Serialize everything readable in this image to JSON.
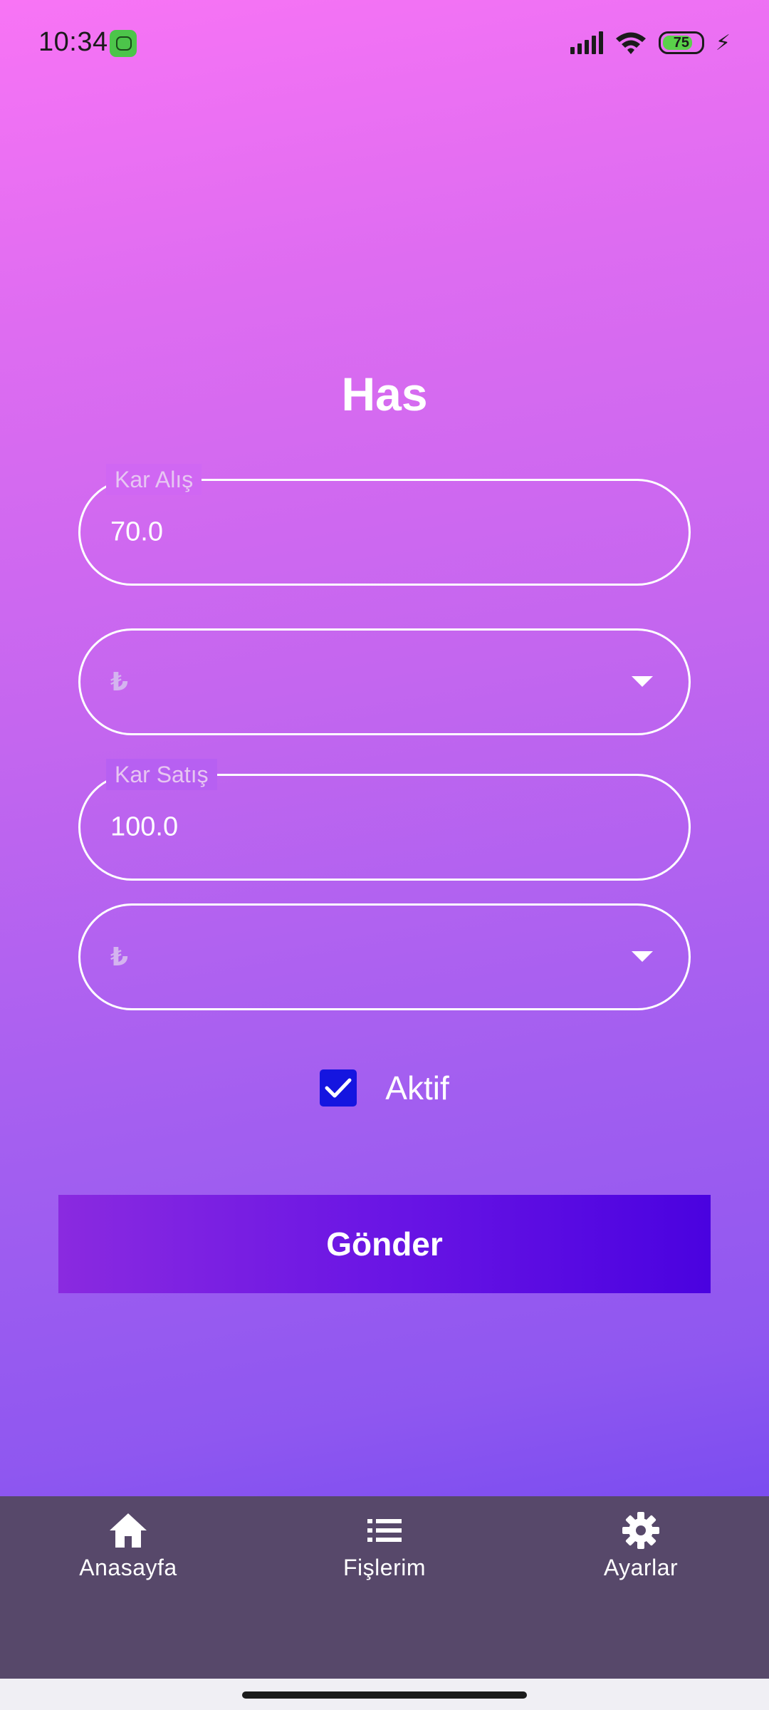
{
  "status_bar": {
    "time": "10:34",
    "battery_level": "75",
    "icons": [
      "app-badge-icon",
      "signal-icon",
      "wifi-icon",
      "battery-icon",
      "charging-bolt-icon"
    ]
  },
  "page": {
    "title": "Has"
  },
  "form": {
    "buy_profit": {
      "label": "Kar Alış",
      "value": "70.0"
    },
    "buy_currency": {
      "value": "₺"
    },
    "sell_profit": {
      "label": "Kar Satış",
      "value": "100.0"
    },
    "sell_currency": {
      "value": "₺"
    },
    "active": {
      "label": "Aktif",
      "checked": true
    },
    "submit_label": "Gönder"
  },
  "bottom_nav": {
    "items": [
      {
        "label": "Anasayfa",
        "icon": "home-icon"
      },
      {
        "label": "Fişlerim",
        "icon": "list-icon"
      },
      {
        "label": "Ayarlar",
        "icon": "gear-icon"
      }
    ]
  },
  "colors": {
    "gradient_top": "#f874f5",
    "gradient_bottom": "#7c4df0",
    "checkbox": "#1515e0",
    "submit_left": "#8a2ae0",
    "submit_right": "#4a02e0",
    "nav_background": "#57486a"
  }
}
